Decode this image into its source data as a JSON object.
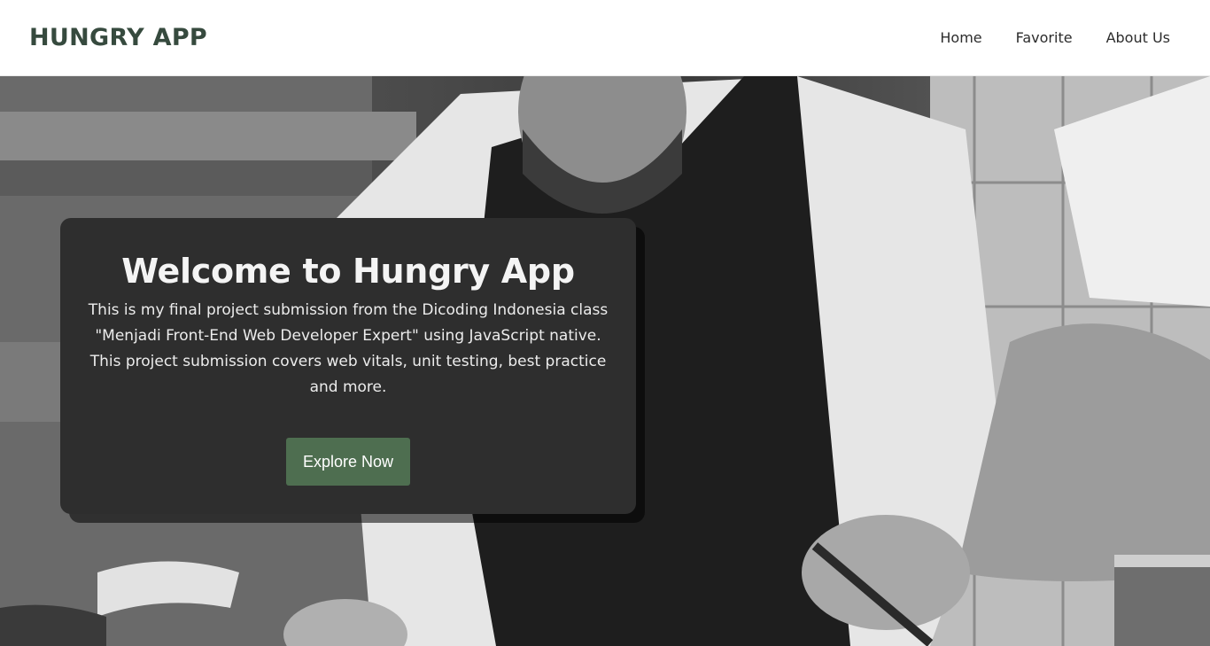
{
  "header": {
    "brand": "HUNGRY APP",
    "nav": [
      {
        "label": "Home"
      },
      {
        "label": "Favorite"
      },
      {
        "label": "About Us"
      }
    ]
  },
  "hero": {
    "title": "Welcome to Hungry App",
    "description": "This is my final project submission from the Dicoding Indonesia class \"Menjadi Front-End Web Developer Expert\" using JavaScript native. This project submission covers web vitals, unit testing, best practice and more.",
    "cta_label": "Explore Now",
    "background": "chef-photo"
  },
  "colors": {
    "brand": "#364a3e",
    "card": "#2e2e2e",
    "cta": "#4e6e50"
  }
}
